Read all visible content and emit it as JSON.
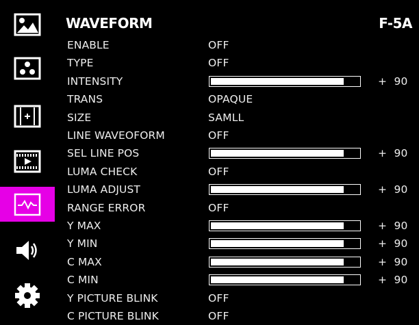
{
  "header": {
    "title": "WAVEFORM",
    "model": "F-5A"
  },
  "sidebar": {
    "items": [
      {
        "icon": "image-icon",
        "active": false
      },
      {
        "icon": "color-dots-icon",
        "active": false
      },
      {
        "icon": "marker-icon",
        "active": false
      },
      {
        "icon": "film-play-icon",
        "active": false
      },
      {
        "icon": "waveform-icon",
        "active": true
      },
      {
        "icon": "speaker-icon",
        "active": false
      },
      {
        "icon": "gear-icon",
        "active": false
      }
    ]
  },
  "colors": {
    "accent": "#e600e6",
    "background": "#000000",
    "text": "#ffffff"
  },
  "menu": [
    {
      "label": "ENABLE",
      "value": "OFF"
    },
    {
      "label": "TYPE",
      "value": "OFF"
    },
    {
      "label": "INTENSITY",
      "level": 90,
      "level_max": 100,
      "number": "+  90"
    },
    {
      "label": "TRANS",
      "value": "OPAQUE"
    },
    {
      "label": "SIZE",
      "value": "SAMLL"
    },
    {
      "label": "LINE WAVEOFORM",
      "value": "OFF"
    },
    {
      "label": "SEL LINE POS",
      "level": 90,
      "level_max": 100,
      "number": "+  90"
    },
    {
      "label": "LUMA CHECK",
      "value": "OFF"
    },
    {
      "label": "LUMA ADJUST",
      "level": 90,
      "level_max": 100,
      "number": "+  90"
    },
    {
      "label": "RANGE ERROR",
      "value": "OFF"
    },
    {
      "label": "Y MAX",
      "level": 90,
      "level_max": 100,
      "number": "+  90"
    },
    {
      "label": "Y MIN",
      "level": 90,
      "level_max": 100,
      "number": "+  90"
    },
    {
      "label": "C MAX",
      "level": 90,
      "level_max": 100,
      "number": "+  90"
    },
    {
      "label": "C MIN",
      "level": 90,
      "level_max": 100,
      "number": "+  90"
    },
    {
      "label": "Y PICTURE BLINK",
      "value": "OFF"
    },
    {
      "label": "C PICTURE BLINK",
      "value": "OFF"
    }
  ]
}
